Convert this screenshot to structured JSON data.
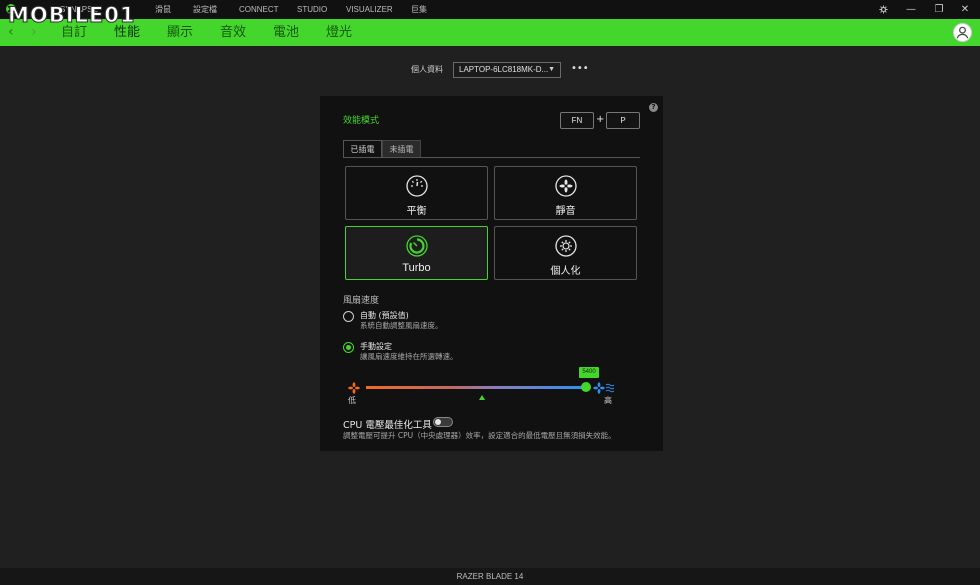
{
  "watermark": "MOBILE01",
  "topnav": {
    "items": [
      "SYNAPSE",
      "滑鼠",
      "設定檔",
      "CONNECT",
      "STUDIO",
      "VISUALIZER",
      "巨集"
    ]
  },
  "window_controls": {
    "settings_icon": "gear-icon",
    "minimize": "—",
    "restore": "❐",
    "close": "✕"
  },
  "subnav": {
    "tabs": [
      "自訂",
      "性能",
      "顯示",
      "音效",
      "電池",
      "燈光"
    ],
    "active": "性能",
    "back": "‹",
    "forward": "›"
  },
  "profile": {
    "label": "個人資料",
    "selected": "LAPTOP-6LC818MK-D...",
    "more": "•••"
  },
  "performance": {
    "title": "效能模式",
    "help": "?",
    "shortcut": {
      "key1": "FN",
      "plus": "+",
      "key2": "P"
    },
    "power_tabs": [
      "已插電",
      "未插電"
    ],
    "modes": [
      {
        "label": "平衡",
        "icon": "speedometer-icon"
      },
      {
        "label": "靜音",
        "icon": "fan-icon"
      },
      {
        "label": "Turbo",
        "icon": "turbo-gauge-icon",
        "active": true
      },
      {
        "label": "個人化",
        "icon": "gear-icon"
      }
    ]
  },
  "fan_speed": {
    "title": "風扇速度",
    "options": [
      {
        "label": "自動 (預設值)",
        "desc": "系統自動調整風扇速度。",
        "checked": false
      },
      {
        "label": "手動設定",
        "desc": "讓風扇速度維持在所選轉速。",
        "checked": true
      }
    ],
    "slider": {
      "value": "5400",
      "low_label": "低",
      "high_label": "高",
      "level": 0.97
    }
  },
  "cpu": {
    "label": "CPU 電壓最佳化工具",
    "enabled": false,
    "desc": "調整電壓可提升 CPU（中央處理器）效率，設定適合的最低電壓且無須損失效能。"
  },
  "footer": {
    "device": "RAZER BLADE 14"
  },
  "colors": {
    "accent": "#44d62c",
    "background": "#202020",
    "panel": "#111111"
  }
}
